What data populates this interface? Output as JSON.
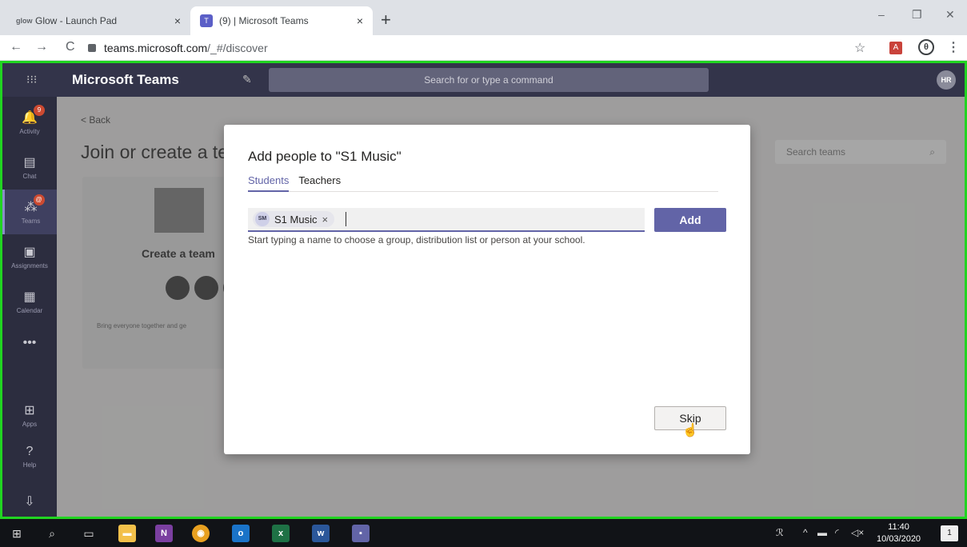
{
  "browser": {
    "tabs": [
      {
        "title": "Glow - Launch Pad",
        "favicon": "glow-icon",
        "favicon_text": "glow",
        "close": "×"
      },
      {
        "title": "(9) | Microsoft Teams",
        "favicon": "teams-icon",
        "favicon_text": "T",
        "close": "×"
      }
    ],
    "new_tab": "+",
    "window_controls": {
      "minimize": "–",
      "restore": "❐",
      "close": "✕"
    },
    "nav": {
      "back": "←",
      "forward": "→",
      "reload": "C"
    },
    "url_host": "teams.microsoft.com",
    "url_path": "/_#/discover",
    "extensions": {
      "star": "☆",
      "pdf": "A",
      "profile": "θ",
      "menu": "⋮"
    }
  },
  "teams": {
    "header": {
      "waffle": "⁝⁝⁝",
      "app_name": "Microsoft Teams",
      "compose": "✎",
      "search_placeholder": "Search for or type a command",
      "avatar_initials": "HR"
    },
    "rail": [
      {
        "label": "Activity",
        "icon": "bell-icon",
        "glyph": "🔔",
        "badge": "9"
      },
      {
        "label": "Chat",
        "icon": "chat-icon",
        "glyph": "▤",
        "badge": ""
      },
      {
        "label": "Teams",
        "icon": "teams-icon",
        "glyph": "⁂",
        "badge": "@"
      },
      {
        "label": "Assignments",
        "icon": "assignments-icon",
        "glyph": "▣",
        "badge": ""
      },
      {
        "label": "Calendar",
        "icon": "calendar-icon",
        "glyph": "▦",
        "badge": ""
      },
      {
        "label": "",
        "icon": "more-icon",
        "glyph": "•••",
        "badge": ""
      },
      {
        "label": "Apps",
        "icon": "apps-icon",
        "glyph": "⊞",
        "badge": ""
      },
      {
        "label": "Help",
        "icon": "help-icon",
        "glyph": "?",
        "badge": ""
      },
      {
        "label": "",
        "icon": "download-icon",
        "glyph": "⇩",
        "badge": ""
      }
    ],
    "page": {
      "back": "<  Back",
      "title": "Join or create a te",
      "card_title": "Create a team",
      "card_text": "Bring everyone together and ge",
      "search_teams_placeholder": "Search teams",
      "search_icon": "⌕"
    }
  },
  "modal": {
    "title": "Add people to \"S1 Music\"",
    "tabs": [
      {
        "label": "Students",
        "active": true
      },
      {
        "label": "Teachers",
        "active": false
      }
    ],
    "pill_initials": "SM",
    "pill_label": "S1 Music",
    "pill_remove": "×",
    "add_button": "Add",
    "hint": "Start typing a name to choose a group, distribution list or person at your school.",
    "skip_button": "Skip"
  },
  "taskbar": {
    "start": "⊞",
    "search": "⌕",
    "taskview": "▭",
    "apps": [
      {
        "name": "file-explorer-icon",
        "glyph": "▬",
        "color": "#f3c04a"
      },
      {
        "name": "onenote-icon",
        "glyph": "N",
        "color": "#7b3fa0"
      },
      {
        "name": "chrome-icon",
        "glyph": "◉",
        "color": "#e8a020"
      },
      {
        "name": "outlook-icon",
        "glyph": "o",
        "color": "#1a73c8"
      },
      {
        "name": "excel-icon",
        "glyph": "x",
        "color": "#1e7145"
      },
      {
        "name": "word-icon",
        "glyph": "w",
        "color": "#2b579a"
      },
      {
        "name": "teams-taskbar-icon",
        "glyph": "▪",
        "color": "#6264a7"
      }
    ],
    "tray": {
      "people": "ℛ",
      "chevron": "^",
      "battery": "▬",
      "wifi": "◜",
      "volume": "◁×"
    },
    "time": "11:40",
    "date": "10/03/2020",
    "notification_count": "1"
  }
}
